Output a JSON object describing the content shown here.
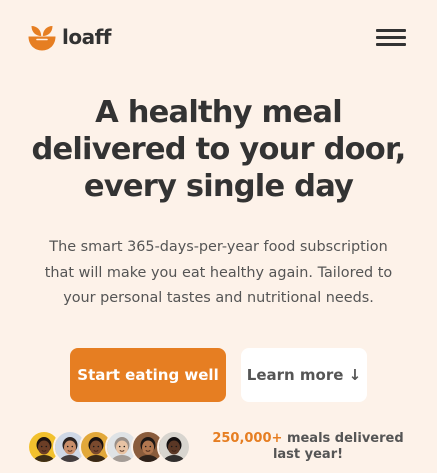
{
  "header": {
    "logo_text": "loaff",
    "logo_icon": "bowl-sprout-icon",
    "menu_icon": "hamburger-menu-icon"
  },
  "hero": {
    "title_line1": "A healthy meal",
    "title_line2": "delivered to your door,",
    "title_line3": "every single day",
    "description_line1": "The smart 365-days-per-year food subscription",
    "description_line2": "that will make you eat healthy again. Tailored to",
    "description_line3": "your personal tastes and nutritional needs."
  },
  "buttons": {
    "primary_label": "Start eating well",
    "secondary_label": "Learn more ↓"
  },
  "customers": {
    "count_highlight": "250,000+",
    "text_rest": " meals delivered",
    "text_line2": "last year!",
    "avatars": [
      {
        "name": "customer-avatar-1",
        "bg": "#f2c12e",
        "skin": "#6b3e26",
        "hair": "#1e1410"
      },
      {
        "name": "customer-avatar-2",
        "bg": "#cfd8e6",
        "skin": "#c98e6a",
        "hair": "#2a2220"
      },
      {
        "name": "customer-avatar-3",
        "bg": "#e2a83a",
        "skin": "#7a4a2e",
        "hair": "#1a1210"
      },
      {
        "name": "customer-avatar-4",
        "bg": "#dfe3e6",
        "skin": "#e8c3a4",
        "hair": "#9a8f87"
      },
      {
        "name": "customer-avatar-5",
        "bg": "#8a5c3c",
        "skin": "#b0764f",
        "hair": "#1c1614"
      },
      {
        "name": "customer-avatar-6",
        "bg": "#d8d5cf",
        "skin": "#5a3725",
        "hair": "#141010"
      }
    ]
  },
  "colors": {
    "accent": "#e67e22",
    "background": "#fdf2e9",
    "text_dark": "#333333",
    "text_body": "#555555"
  }
}
